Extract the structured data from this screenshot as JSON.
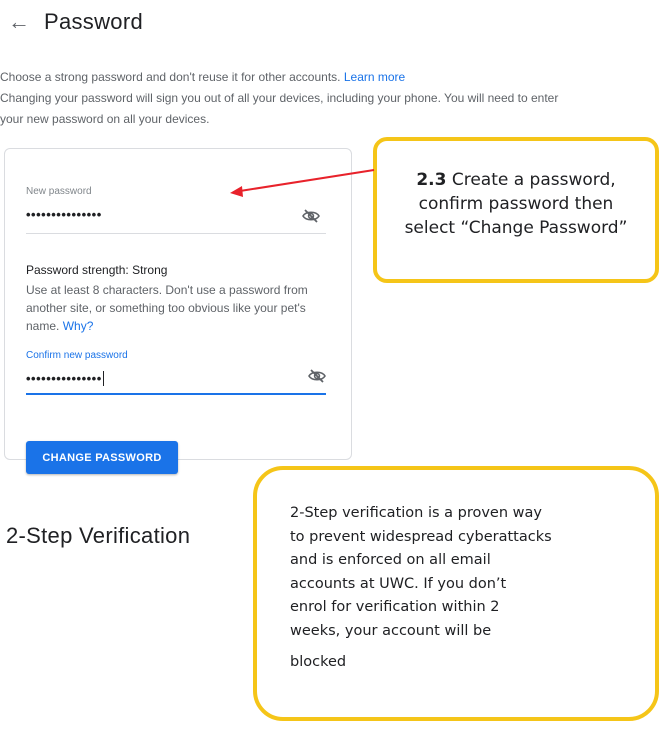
{
  "header": {
    "back_icon": "arrow-left-icon",
    "title": "Password"
  },
  "intro": {
    "line1": "Choose a strong password and don't reuse it for other accounts.",
    "learn_more": "Learn more",
    "line2a": "Changing your password will sign you out of all your devices, including your phone. You will need to enter",
    "line2b": "your new password on all your devices."
  },
  "form": {
    "new_password_label": "New password",
    "new_password_value": "•••••••••••••••",
    "strength_label": "Password strength:",
    "strength_value": "Strong",
    "hint": "Use at least 8 characters. Don't use a password from another site, or something too obvious like your pet's name.",
    "why_link": "Why?",
    "confirm_label": "Confirm new password",
    "confirm_value": "•••••••••••••••",
    "visibility_icon": "eye-off-icon",
    "change_button": "CHANGE PASSWORD"
  },
  "section": {
    "title": "2-Step Verification"
  },
  "callouts": {
    "step_number": "2.3",
    "step_text_1": " Create a password,",
    "step_text_2": "confirm password then",
    "step_text_3": "select “Change Password”",
    "note_1": "2-Step verification is a proven way",
    "note_2": "to prevent widespread cyberattacks",
    "note_3": "and is enforced on all email",
    "note_4": "accounts at UWC. If you don’t",
    "note_5": "enrol for verification within 2",
    "note_6": "weeks, your account will be",
    "note_7": "blocked"
  },
  "colors": {
    "accent": "#1a73e8",
    "callout_border": "#f5c518",
    "arrow": "#e8222b"
  }
}
